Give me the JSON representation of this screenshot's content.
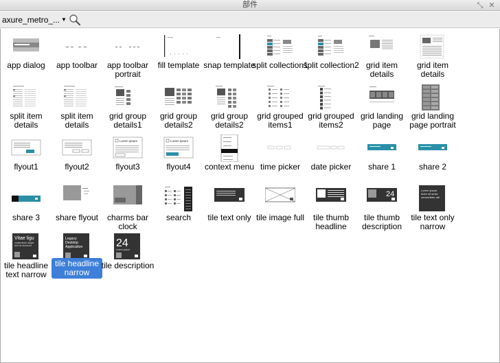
{
  "window": {
    "title": "部件"
  },
  "toolbar": {
    "library_name": "axure_metro_..."
  },
  "items": [
    {
      "label": "app dialog",
      "thumb": "app-dialog"
    },
    {
      "label": "app toolbar",
      "thumb": "app-toolbar"
    },
    {
      "label": "app toolbar portrait",
      "thumb": "app-toolbar-portrait"
    },
    {
      "label": "fill template",
      "thumb": "fill-template"
    },
    {
      "label": "snap template",
      "thumb": "snap-template"
    },
    {
      "label": "split collection1",
      "thumb": "split-collection"
    },
    {
      "label": "split collection2",
      "thumb": "split-collection"
    },
    {
      "label": "grid item details",
      "thumb": "grid-item-details"
    },
    {
      "label": "grid item details",
      "thumb": "grid-item-details-2"
    },
    {
      "label": "split item details",
      "thumb": "split-item-details"
    },
    {
      "label": "split item details",
      "thumb": "split-item-details"
    },
    {
      "label": "grid group details1",
      "thumb": "grid-group-details1"
    },
    {
      "label": "grid group details2",
      "thumb": "grid-group-details2"
    },
    {
      "label": "grid group details2",
      "thumb": "grid-group-details3"
    },
    {
      "label": "grid grouped items1",
      "thumb": "grid-grouped-items"
    },
    {
      "label": "grid grouped items2",
      "thumb": "grid-grouped-items2"
    },
    {
      "label": "grid landing page",
      "thumb": "grid-landing"
    },
    {
      "label": "grid landing page portrait",
      "thumb": "grid-landing-portrait"
    },
    {
      "label": "flyout1",
      "thumb": "flyout1"
    },
    {
      "label": "flyout2",
      "thumb": "flyout2"
    },
    {
      "label": "flyout3",
      "thumb": "flyout3",
      "text": "Lorem ipsum"
    },
    {
      "label": "flyout4",
      "thumb": "flyout4",
      "text": "Lorem ipsum"
    },
    {
      "label": "context menu",
      "thumb": "context-menu"
    },
    {
      "label": "time picker",
      "thumb": "time-picker"
    },
    {
      "label": "date picker",
      "thumb": "date-picker"
    },
    {
      "label": "share 1",
      "thumb": "share"
    },
    {
      "label": "share 2",
      "thumb": "share"
    },
    {
      "label": "share 3",
      "thumb": "share3"
    },
    {
      "label": "share flyout",
      "thumb": "share-flyout"
    },
    {
      "label": "charms bar clock",
      "thumb": "charms-bar"
    },
    {
      "label": "search",
      "thumb": "search-page"
    },
    {
      "label": "tile text only",
      "thumb": "tile-text-only"
    },
    {
      "label": "tile image full",
      "thumb": "tile-image-full"
    },
    {
      "label": "tile thumb headline",
      "thumb": "tile-thumb-headline"
    },
    {
      "label": "tile thumb description",
      "thumb": "tile-thumb-desc",
      "text": "24"
    },
    {
      "label": "tile text only narrow",
      "thumb": "tile-text-narrow",
      "lines": [
        "Lorem ipsum",
        "dolor sit amet,",
        "consectetur adi"
      ]
    },
    {
      "label": "tile headline text narrow",
      "thumb": "tile-headline-text",
      "lines": [
        "Vitae ligu",
        "consectetur adipis",
        "sed do eiusmod"
      ]
    },
    {
      "label": "tile headline narrow",
      "thumb": "tile-headline",
      "selected": true,
      "lines": [
        "Legacy",
        "Desktop",
        "Application"
      ]
    },
    {
      "label": "tile description",
      "thumb": "tile-description",
      "text": "24",
      "sub": "Lorem ipsum"
    }
  ],
  "colors": {
    "selection": "#3d7fd9",
    "accent_teal": "#2a8fa8",
    "dark_tile": "#333333"
  }
}
